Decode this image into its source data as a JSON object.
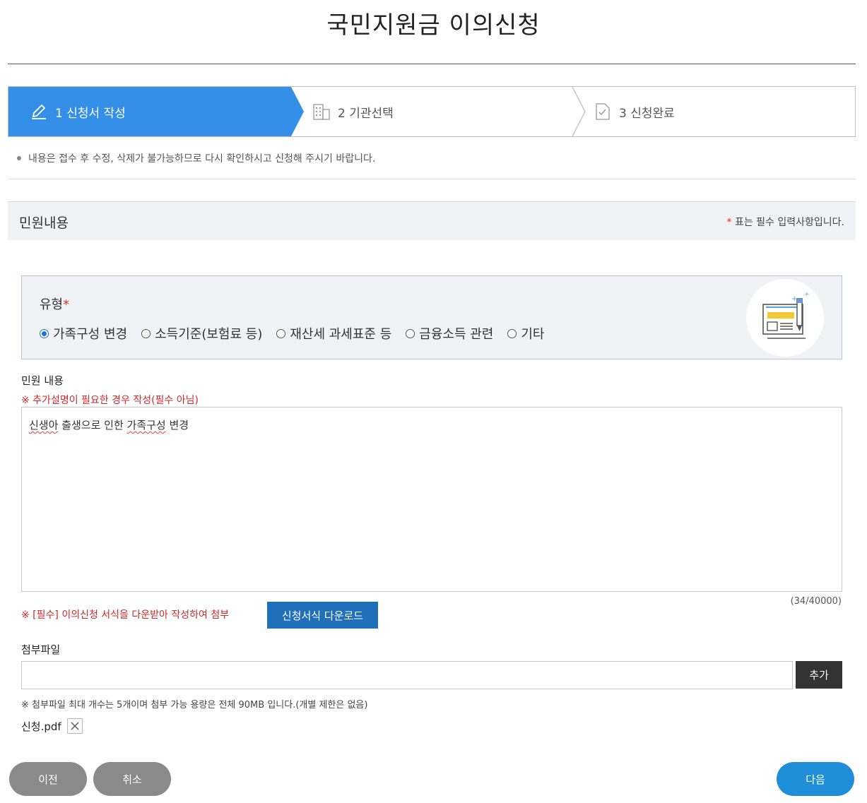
{
  "page": {
    "title": "국민지원금 이의신청"
  },
  "steps": [
    {
      "label": "1 신청서 작성",
      "icon": "pencil-icon",
      "active": true
    },
    {
      "label": "2 기관선택",
      "icon": "building-icon",
      "active": false
    },
    {
      "label": "3 신청완료",
      "icon": "document-check-icon",
      "active": false
    }
  ],
  "notice": "내용은 접수 후 수정, 삭제가 불가능하므로 다시 확인하시고 신청해 주시기 바랍니다.",
  "section": {
    "title": "민원내용",
    "required_star": "*",
    "required_note": "표는 필수 입력사항입니다."
  },
  "type": {
    "label": "유형",
    "required_star": "*",
    "options": [
      {
        "label": "가족구성 변경",
        "selected": true
      },
      {
        "label": "소득기준(보험료 등)",
        "selected": false
      },
      {
        "label": "재산세 과세표준 등",
        "selected": false
      },
      {
        "label": "금융소득 관련",
        "selected": false
      },
      {
        "label": "기타",
        "selected": false
      }
    ]
  },
  "complaint": {
    "label": "민원 내용",
    "note": "※ 추가설명이 필요한 경우 작성(필수 아님)",
    "text_parts": [
      "신생아",
      " 출생으로 인한 ",
      "가족구성",
      " 변경"
    ],
    "counter": "(34/40000)"
  },
  "form_download": {
    "note": "※ [필수] 이의신청 서식을 다운받아 작성하여 첨부",
    "button": "신청서식 다운로드"
  },
  "attachment": {
    "label": "첨부파일",
    "input_value": "",
    "add_button": "추가",
    "limit_note": "※ 첨부파일 최대 개수는 5개이며 첨부 가능 용량은 전체 90MB 입니다.(개별 제한은 없음)",
    "files": [
      "신청.pdf"
    ]
  },
  "buttons": {
    "prev": "이전",
    "cancel": "취소",
    "next": "다음"
  },
  "colors": {
    "active_step": "#338fe8",
    "primary": "#1f6fba",
    "next_button": "#1f8ed8",
    "required": "#d9302b"
  }
}
